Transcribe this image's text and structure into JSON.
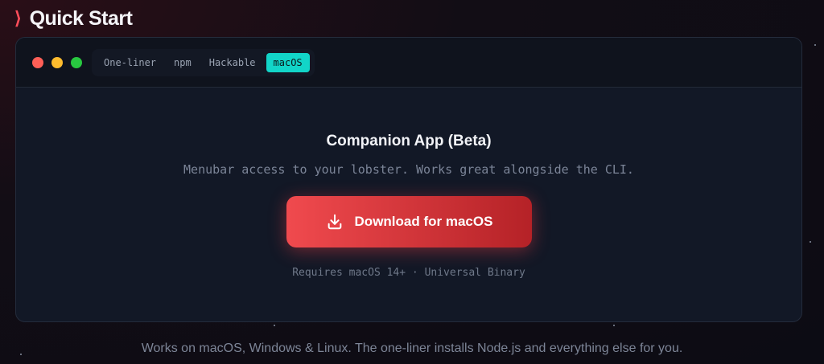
{
  "header": {
    "title": "Quick Start"
  },
  "tabs": [
    {
      "label": "One-liner"
    },
    {
      "label": "npm"
    },
    {
      "label": "Hackable"
    },
    {
      "label": "macOS"
    }
  ],
  "panel": {
    "title": "Companion App (Beta)",
    "subtitle": "Menubar access to your lobster. Works great alongside the CLI.",
    "download_label": "Download for macOS",
    "requirements": "Requires macOS 14+ · Universal Binary"
  },
  "footer": {
    "text": "Works on macOS, Windows & Linux. The one-liner installs Node.js and everything else for you."
  },
  "colors": {
    "accent": "#ff4d5a",
    "active_tab": "#12d5c8",
    "button_start": "#f04a4e",
    "button_end": "#b52227"
  },
  "icons": {
    "chevron": "chevron-right-icon",
    "download": "download-icon"
  }
}
